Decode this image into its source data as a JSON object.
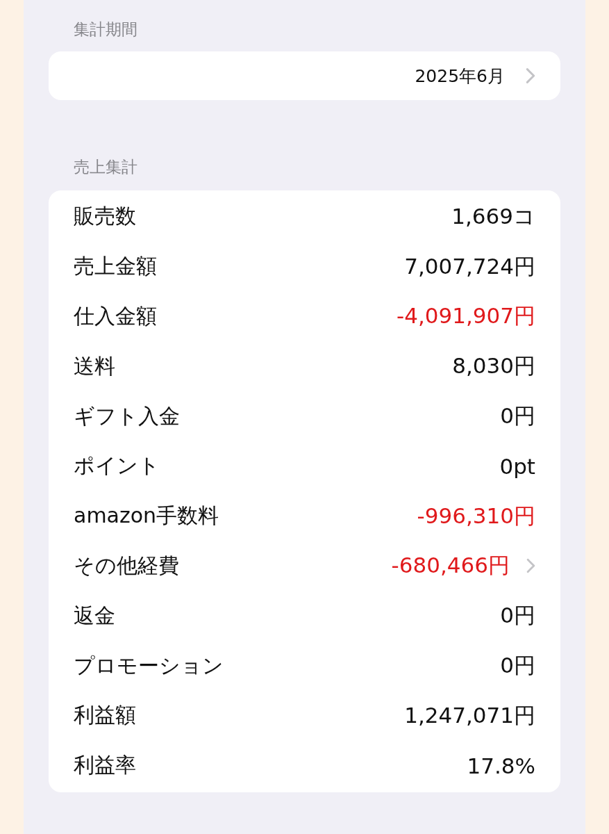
{
  "period_section": {
    "header": "集計期間",
    "value": "2025年6月"
  },
  "sales_section": {
    "header": "売上集計",
    "rows": [
      {
        "label": "販売数",
        "value": "1,669コ",
        "negative": false,
        "chevron": false
      },
      {
        "label": "売上金額",
        "value": "7,007,724円",
        "negative": false,
        "chevron": false
      },
      {
        "label": "仕入金額",
        "value": "-4,091,907円",
        "negative": true,
        "chevron": false
      },
      {
        "label": "送料",
        "value": "8,030円",
        "negative": false,
        "chevron": false
      },
      {
        "label": "ギフト入金",
        "value": "0円",
        "negative": false,
        "chevron": false
      },
      {
        "label": "ポイント",
        "value": "0pt",
        "negative": false,
        "chevron": false
      },
      {
        "label": "amazon手数料",
        "value": "-996,310円",
        "negative": true,
        "chevron": false
      },
      {
        "label": "その他経費",
        "value": "-680,466円",
        "negative": true,
        "chevron": true
      },
      {
        "label": "返金",
        "value": "0円",
        "negative": false,
        "chevron": false
      },
      {
        "label": "プロモーション",
        "value": "0円",
        "negative": false,
        "chevron": false
      },
      {
        "label": "利益額",
        "value": "1,247,071円",
        "negative": false,
        "chevron": false
      },
      {
        "label": "利益率",
        "value": "17.8%",
        "negative": false,
        "chevron": false
      }
    ]
  }
}
